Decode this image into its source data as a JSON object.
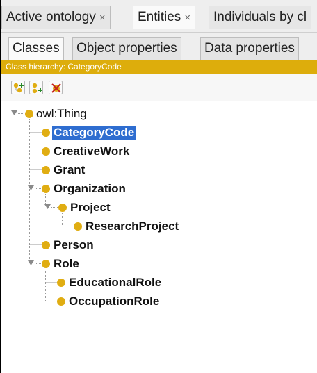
{
  "top_tabs": [
    {
      "label": "Active ontology",
      "close": "×"
    },
    {
      "label": "Entities",
      "close": "×"
    },
    {
      "label": "Individuals by cl",
      "close": ""
    }
  ],
  "sub_tabs": [
    {
      "label": "Classes"
    },
    {
      "label": "Object properties"
    },
    {
      "label": "Data properties"
    }
  ],
  "hierarchy_header": "Class hierarchy: CategoryCode",
  "toolbar": {
    "add_subclass_icon": "add-subclass-icon",
    "add_sibling_icon": "add-sibling-icon",
    "delete_icon": "delete-class-icon"
  },
  "tree": {
    "root": "owl:Thing",
    "nodes": [
      {
        "label": "CategoryCode",
        "selected": true
      },
      {
        "label": "CreativeWork"
      },
      {
        "label": "Grant"
      },
      {
        "label": "Organization",
        "expanded": true
      },
      {
        "label": "Project",
        "expanded": true
      },
      {
        "label": "ResearchProject"
      },
      {
        "label": "Person"
      },
      {
        "label": "Role",
        "expanded": true
      },
      {
        "label": "EducationalRole"
      },
      {
        "label": "OccupationRole"
      }
    ]
  },
  "colors": {
    "accent": "#ddad0c",
    "class_dot": "#e0ad12",
    "selection": "#2e6dd0"
  }
}
